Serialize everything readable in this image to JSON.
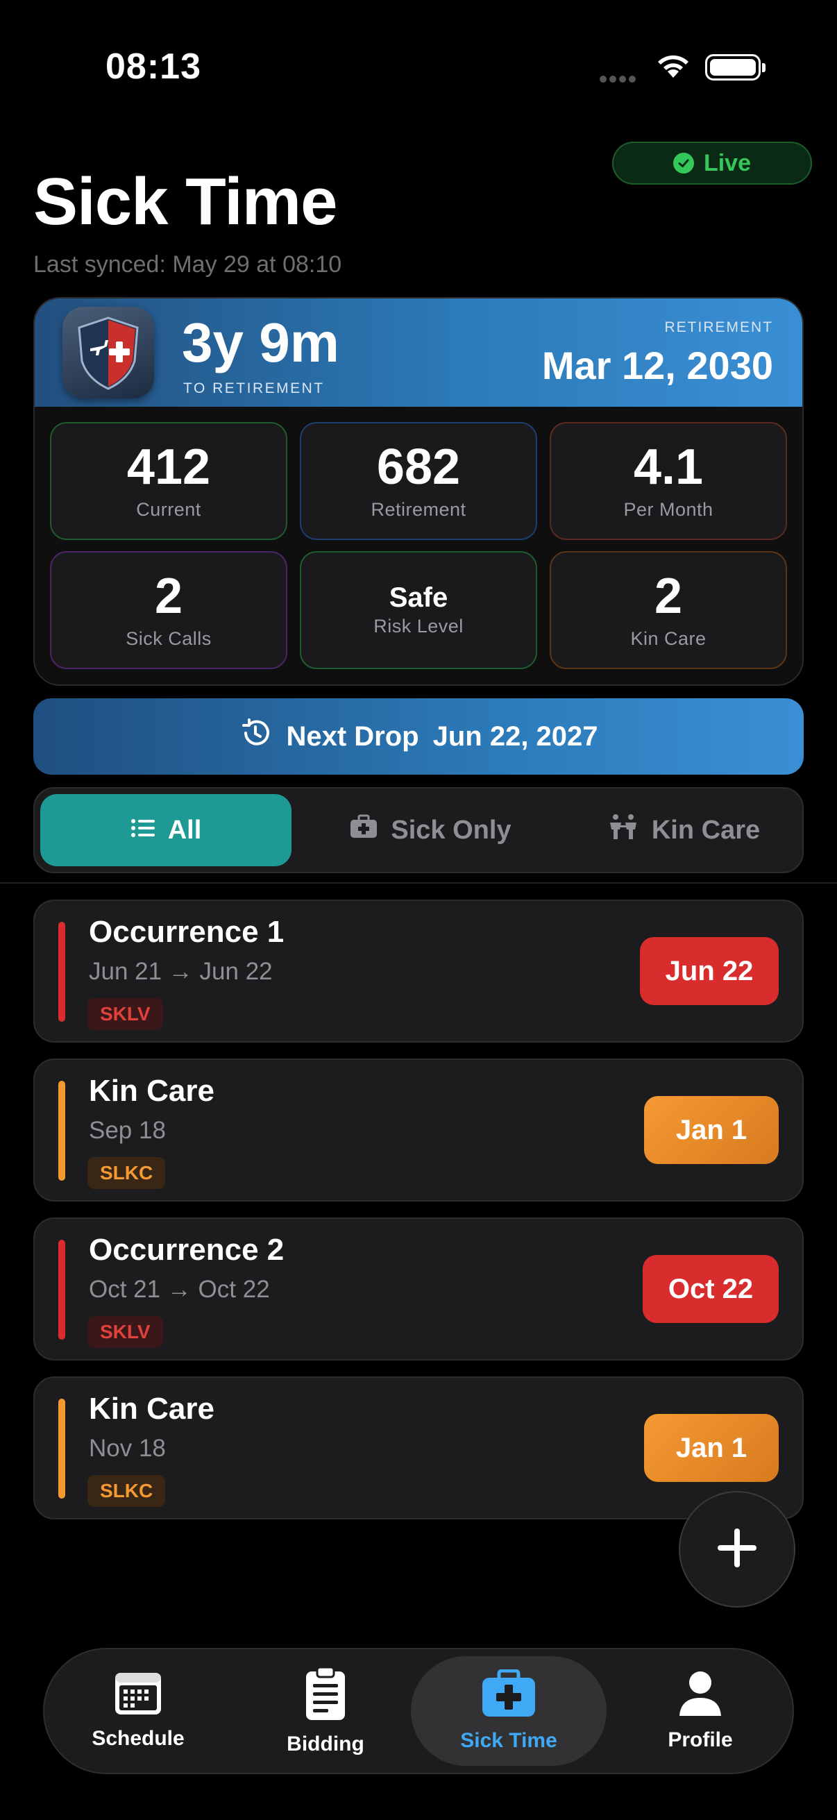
{
  "status_bar": {
    "time": "08:13"
  },
  "header": {
    "live_label": "Live",
    "title": "Sick Time",
    "last_synced": "Last synced: May 29 at 08:10"
  },
  "summary": {
    "countdown": "3y 9m",
    "countdown_label": "TO RETIREMENT",
    "retirement_label": "RETIREMENT",
    "retirement_date": "Mar 12, 2030",
    "stats": [
      {
        "value": "412",
        "label": "Current",
        "border": "#1f5b2e"
      },
      {
        "value": "682",
        "label": "Retirement",
        "border": "#1b3f6e"
      },
      {
        "value": "4.1",
        "label": "Per Month",
        "border": "#5a2a22"
      },
      {
        "value": "2",
        "label": "Sick Calls",
        "border": "#4b2563"
      },
      {
        "value": "Safe",
        "label": "Risk Level",
        "border": "#1f5b2e"
      },
      {
        "value": "2",
        "label": "Kin Care",
        "border": "#5a3616"
      }
    ]
  },
  "next_drop": {
    "label": "Next Drop",
    "date": "Jun 22, 2027"
  },
  "filter": {
    "options": [
      {
        "label": "All",
        "icon": "list-icon",
        "active": true
      },
      {
        "label": "Sick Only",
        "icon": "briefcase-medical-icon",
        "active": false
      },
      {
        "label": "Kin Care",
        "icon": "family-icon",
        "active": false
      }
    ]
  },
  "entries": [
    {
      "title": "Occurrence 1",
      "dates": "Jun 21 → Jun 22",
      "code": "SKLV",
      "drop": "Jun 22",
      "kind": "sick"
    },
    {
      "title": "Kin Care",
      "dates": "Sep 18",
      "code": "SLKC",
      "drop": "Jan 1",
      "kind": "kin"
    },
    {
      "title": "Occurrence 2",
      "dates": "Oct 21 → Oct 22",
      "code": "SKLV",
      "drop": "Oct 22",
      "kind": "sick"
    },
    {
      "title": "Kin Care",
      "dates": "Nov 18",
      "code": "SLKC",
      "drop": "Jan 1",
      "kind": "kin"
    }
  ],
  "tabs": [
    {
      "label": "Schedule",
      "icon": "calendar-icon"
    },
    {
      "label": "Bidding",
      "icon": "clipboard-icon"
    },
    {
      "label": "Sick Time",
      "icon": "medical-kit-icon",
      "active": true
    },
    {
      "label": "Profile",
      "icon": "person-icon"
    }
  ],
  "colors": {
    "accent_teal": "#1e9a94",
    "accent_blue": "#2c7ab8",
    "sick_red": "#d92d2d",
    "kin_orange": "#f59a33",
    "live_green": "#34c759"
  }
}
